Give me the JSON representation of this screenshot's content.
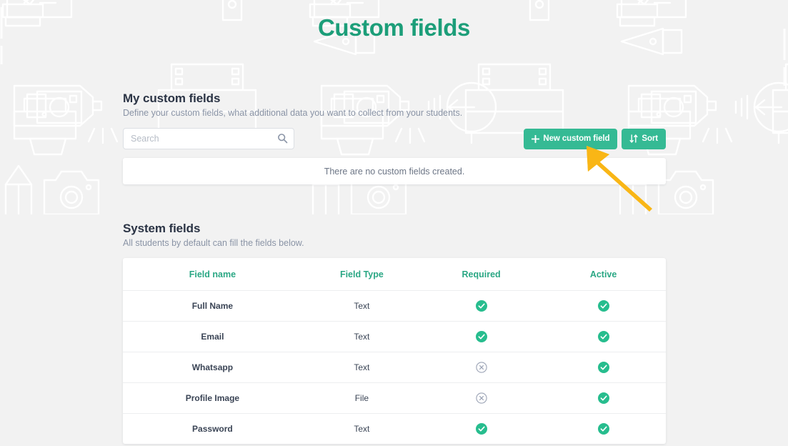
{
  "page": {
    "title": "Custom fields",
    "title_color": "#1c9e79",
    "background_color": "#f2f2f2"
  },
  "custom_fields_section": {
    "heading": "My custom fields",
    "subheading": "Define your custom fields, what additional data you want to collect from your students.",
    "search": {
      "placeholder": "Search",
      "value": "",
      "icon": "search-icon"
    },
    "buttons": [
      {
        "label": "New custom field",
        "icon": "plus-icon",
        "color": "#35ba94"
      },
      {
        "label": "Sort",
        "icon": "sort-arrows-icon",
        "color": "#35ba94"
      }
    ],
    "empty_message": "There are no custom fields created."
  },
  "system_fields_section": {
    "heading": "System fields",
    "subheading": "All students by default can fill the fields below.",
    "table": {
      "headers": [
        "Field name",
        "Field Type",
        "Required",
        "Active"
      ],
      "header_color": "#2aa784",
      "rows": [
        {
          "name": "Full Name",
          "type": "Text",
          "required": "check",
          "active": "check"
        },
        {
          "name": "Email",
          "type": "Text",
          "required": "check",
          "active": "check"
        },
        {
          "name": "Whatsapp",
          "type": "Text",
          "required": "cross",
          "active": "check"
        },
        {
          "name": "Profile Image",
          "type": "File",
          "required": "cross",
          "active": "check"
        },
        {
          "name": "Password",
          "type": "Text",
          "required": "check",
          "active": "check"
        }
      ]
    }
  },
  "annotation": {
    "type": "arrow",
    "color": "#f9b616",
    "points_to": "New custom field"
  }
}
